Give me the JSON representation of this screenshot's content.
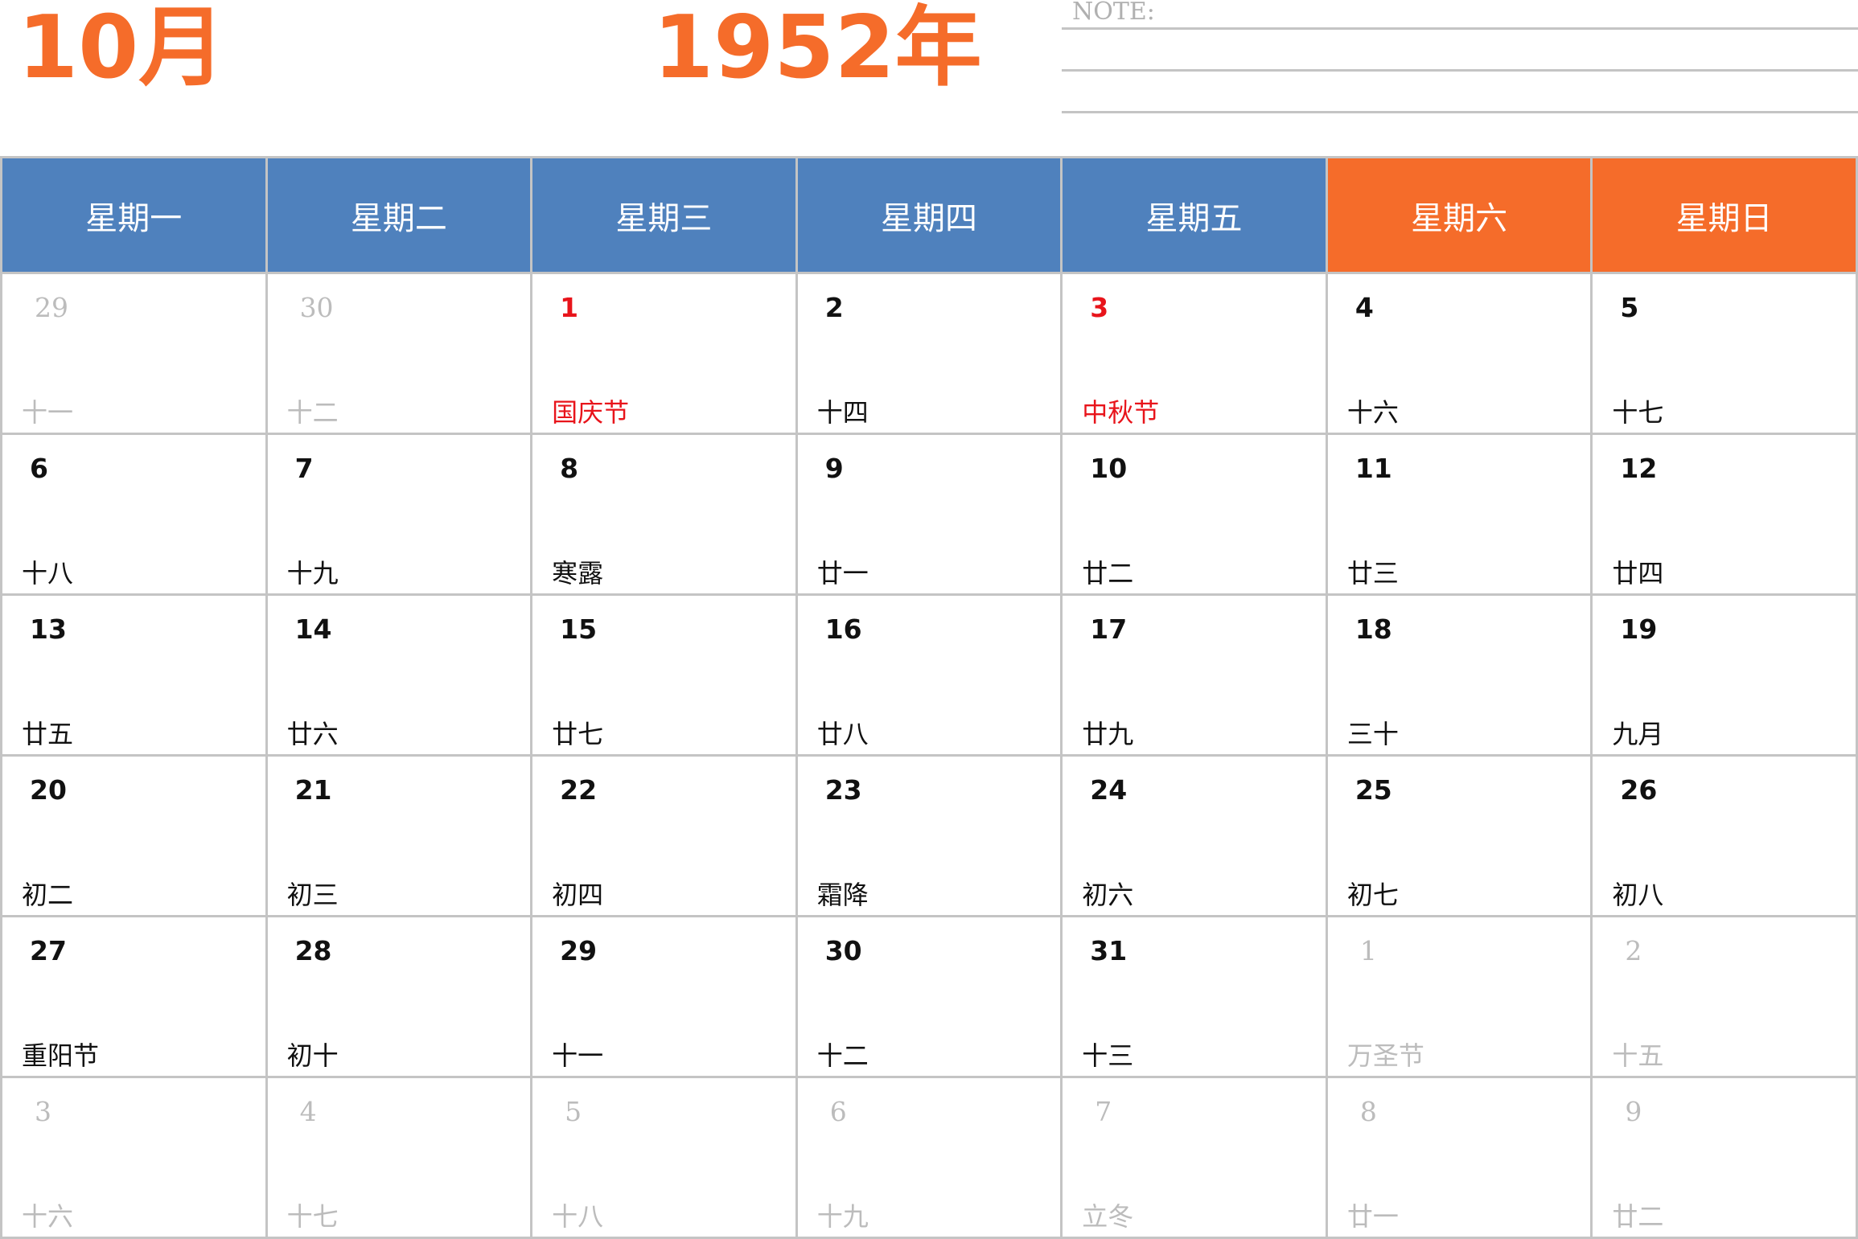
{
  "header": {
    "month": "10月",
    "year": "1952年",
    "note_label": "NOTE:"
  },
  "colors": {
    "accent_orange": "#f56c2a",
    "weekday_blue": "#4f81bd",
    "holiday_red": "#e8141b",
    "other_month_gray": "#bcbcbc"
  },
  "weekdays": [
    {
      "label": "星期一",
      "weekend": false
    },
    {
      "label": "星期二",
      "weekend": false
    },
    {
      "label": "星期三",
      "weekend": false
    },
    {
      "label": "星期四",
      "weekend": false
    },
    {
      "label": "星期五",
      "weekend": false
    },
    {
      "label": "星期六",
      "weekend": true
    },
    {
      "label": "星期日",
      "weekend": true
    }
  ],
  "weeks": [
    [
      {
        "day": "29",
        "lunar": "十一",
        "other": true
      },
      {
        "day": "30",
        "lunar": "十二",
        "other": true
      },
      {
        "day": "1",
        "lunar": "国庆节",
        "holiday": true
      },
      {
        "day": "2",
        "lunar": "十四"
      },
      {
        "day": "3",
        "lunar": "中秋节",
        "holiday": true
      },
      {
        "day": "4",
        "lunar": "十六"
      },
      {
        "day": "5",
        "lunar": "十七"
      }
    ],
    [
      {
        "day": "6",
        "lunar": "十八"
      },
      {
        "day": "7",
        "lunar": "十九"
      },
      {
        "day": "8",
        "lunar": "寒露"
      },
      {
        "day": "9",
        "lunar": "廿一"
      },
      {
        "day": "10",
        "lunar": "廿二"
      },
      {
        "day": "11",
        "lunar": "廿三"
      },
      {
        "day": "12",
        "lunar": "廿四"
      }
    ],
    [
      {
        "day": "13",
        "lunar": "廿五"
      },
      {
        "day": "14",
        "lunar": "廿六"
      },
      {
        "day": "15",
        "lunar": "廿七"
      },
      {
        "day": "16",
        "lunar": "廿八"
      },
      {
        "day": "17",
        "lunar": "廿九"
      },
      {
        "day": "18",
        "lunar": "三十"
      },
      {
        "day": "19",
        "lunar": "九月"
      }
    ],
    [
      {
        "day": "20",
        "lunar": "初二"
      },
      {
        "day": "21",
        "lunar": "初三"
      },
      {
        "day": "22",
        "lunar": "初四"
      },
      {
        "day": "23",
        "lunar": "霜降"
      },
      {
        "day": "24",
        "lunar": "初六"
      },
      {
        "day": "25",
        "lunar": "初七"
      },
      {
        "day": "26",
        "lunar": "初八"
      }
    ],
    [
      {
        "day": "27",
        "lunar": "重阳节"
      },
      {
        "day": "28",
        "lunar": "初十"
      },
      {
        "day": "29",
        "lunar": "十一"
      },
      {
        "day": "30",
        "lunar": "十二"
      },
      {
        "day": "31",
        "lunar": "十三"
      },
      {
        "day": "1",
        "lunar": "万圣节",
        "other": true
      },
      {
        "day": "2",
        "lunar": "十五",
        "other": true
      }
    ],
    [
      {
        "day": "3",
        "lunar": "十六",
        "other": true
      },
      {
        "day": "4",
        "lunar": "十七",
        "other": true
      },
      {
        "day": "5",
        "lunar": "十八",
        "other": true
      },
      {
        "day": "6",
        "lunar": "十九",
        "other": true
      },
      {
        "day": "7",
        "lunar": "立冬",
        "other": true
      },
      {
        "day": "8",
        "lunar": "廿一",
        "other": true
      },
      {
        "day": "9",
        "lunar": "廿二",
        "other": true
      }
    ]
  ]
}
